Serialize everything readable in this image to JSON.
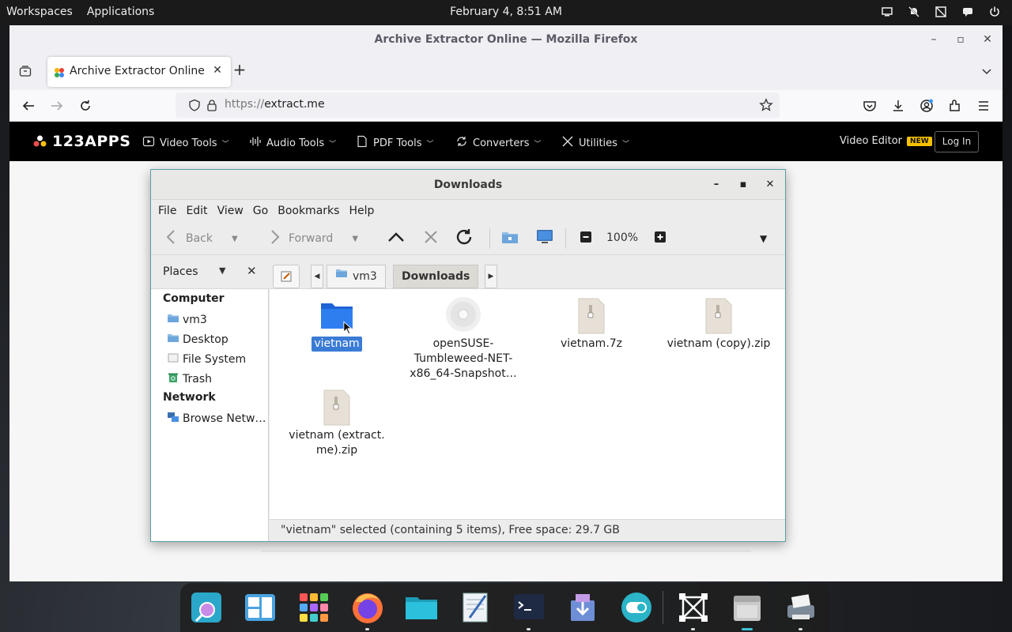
{
  "topbar": {
    "workspaces": "Workspaces",
    "applications": "Applications",
    "clock": "February 4, 8:51 AM",
    "tray_icons": [
      "display-icon",
      "muted-bell-icon",
      "no-network-icon",
      "chat-icon",
      "power-icon"
    ]
  },
  "firefox": {
    "window_title": "Archive Extractor Online — Mozilla Firefox",
    "tab_title": "Archive Extractor Online",
    "new_tab": "+",
    "url_protocol": "https://",
    "url_host": "extract.me"
  },
  "site": {
    "logo": "123APPS",
    "menu": [
      {
        "label": "Video Tools",
        "icon": "play-icon"
      },
      {
        "label": "Audio Tools",
        "icon": "waveform-icon"
      },
      {
        "label": "PDF Tools",
        "icon": "document-icon"
      },
      {
        "label": "Converters",
        "icon": "convert-icon"
      },
      {
        "label": "Utilities",
        "icon": "tools-icon"
      }
    ],
    "video_editor": "Video Editor",
    "new_badge": "NEW",
    "login": "Log In"
  },
  "file_manager": {
    "title": "Downloads",
    "menus": [
      "File",
      "Edit",
      "View",
      "Go",
      "Bookmarks",
      "Help"
    ],
    "toolbar": {
      "back": "Back",
      "forward": "Forward",
      "zoom": "100%"
    },
    "places_label": "Places",
    "breadcrumb": [
      "vm3",
      "Downloads"
    ],
    "sidebar": {
      "computer_heading": "Computer",
      "computer_items": [
        "vm3",
        "Desktop",
        "File System",
        "Trash"
      ],
      "network_heading": "Network",
      "network_items": [
        "Browse Netw…"
      ]
    },
    "files": [
      {
        "name": "vietnam",
        "type": "folder",
        "selected": true
      },
      {
        "name_lines": [
          "openSUSE-",
          "Tumbleweed-NET-",
          "x86_64-Snapshot…"
        ],
        "type": "disc-image"
      },
      {
        "name": "vietnam.7z",
        "type": "archive"
      },
      {
        "name": "vietnam (copy).zip",
        "type": "archive"
      },
      {
        "name_lines": [
          "vietnam (extract.",
          "me).zip"
        ],
        "type": "archive"
      }
    ],
    "status": "\"vietnam\" selected (containing 5 items), Free space: 29.7 GB"
  },
  "dock": {
    "apps": [
      "search-app",
      "file-manager-app",
      "app-grid",
      "firefox-browser",
      "files-folder",
      "text-editor",
      "terminal",
      "software-installer",
      "toggle-settings",
      "screenshot-tool",
      "file-manager-running",
      "printer-scanner"
    ]
  },
  "colors": {
    "selection": "#3a7bd5",
    "folder_blue": "#2f7ef0",
    "site_header": "#000000",
    "new_badge": "#f5c000"
  }
}
